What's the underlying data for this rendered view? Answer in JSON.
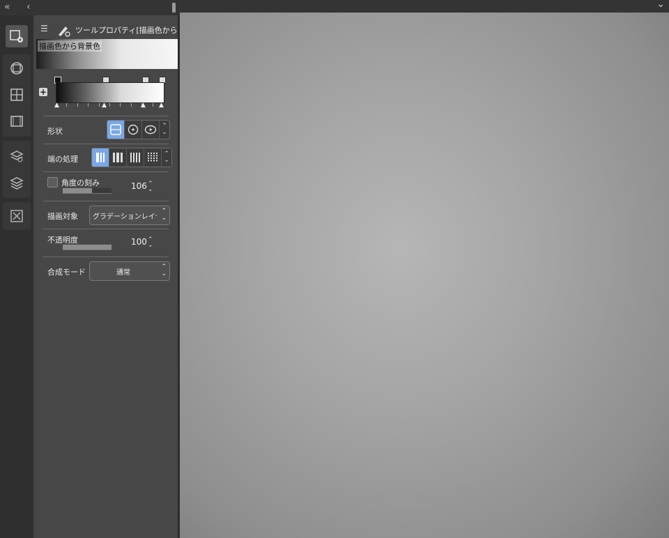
{
  "topbar": {
    "collapse_all": "«",
    "collapse": "‹",
    "expand": "⌄"
  },
  "strip": {
    "icons": [
      {
        "name": "tool-property-icon",
        "active": true
      },
      {
        "name": "sub-view-icon"
      },
      {
        "name": "layer-property-icon"
      },
      {
        "name": "animation-cel-icon"
      },
      {
        "name": "layer-search-icon"
      },
      {
        "name": "layer-icon"
      },
      {
        "name": "close-panel-icon"
      }
    ]
  },
  "panel": {
    "menu_icon": "☰",
    "title": "ツールプロパティ[描画色から",
    "preset_label": "描画色から背景色",
    "add_stop": "+"
  },
  "shape": {
    "label": "形状"
  },
  "edge": {
    "label": "端の処理"
  },
  "angle": {
    "label": "角度の刻み",
    "value": "106",
    "fill": 0.6
  },
  "target": {
    "label": "描画対象",
    "value": "グラデーションレイヤー"
  },
  "opacity": {
    "label": "不透明度",
    "value": "100",
    "fill": 1.0
  },
  "blend": {
    "label": "合成モード",
    "value": "通常"
  },
  "spinner": {
    "up": "⌃",
    "down": "⌄"
  },
  "colors": {
    "panel": "#474747",
    "selected": "#7aa7e6",
    "canvas": "#a8a8a8"
  }
}
